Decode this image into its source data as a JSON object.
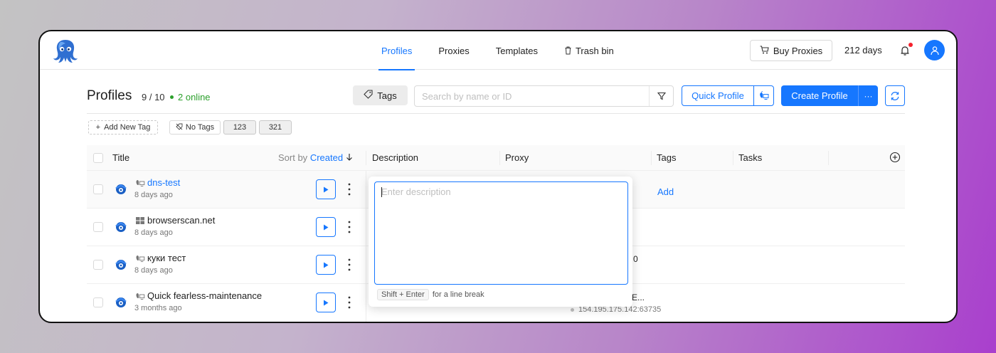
{
  "nav": {
    "items": [
      {
        "label": "Profiles",
        "active": true
      },
      {
        "label": "Proxies",
        "active": false
      },
      {
        "label": "Templates",
        "active": false
      },
      {
        "label": "Trash bin",
        "active": false,
        "icon": "trash-icon"
      }
    ],
    "buy_proxies": "Buy Proxies",
    "days": "212 days"
  },
  "toolbar": {
    "title": "Profiles",
    "count": "9 / 10",
    "online": "2 online",
    "tags_label": "Tags",
    "search_placeholder": "Search by name or ID",
    "quick_profile": "Quick Profile",
    "create_profile": "Create Profile",
    "more_label": "···"
  },
  "tag_chips": {
    "add_new": "Add New Tag",
    "no_tags": "No Tags",
    "tags": [
      "123",
      "321"
    ]
  },
  "table": {
    "headers": {
      "title": "Title",
      "sort_by": "Sort by",
      "sort_field": "Created",
      "description": "Description",
      "proxy": "Proxy",
      "tags": "Tags",
      "tasks": "Tasks"
    },
    "rows": [
      {
        "name": "dns-test",
        "ago": "8 days ago",
        "os": "mac-os-icon",
        "link": true,
        "tags": "Add"
      },
      {
        "name": "browserscan.net",
        "ago": "8 days ago",
        "os": "windows-icon",
        "link": false
      },
      {
        "name": "куки тест",
        "ago": "8 days ago",
        "os": "mac-os-icon",
        "link": false,
        "proxy_fragment": "0"
      },
      {
        "name": "Quick fearless-maintenance",
        "ago": "3 months ago",
        "os": "mac-os-icon",
        "link": false,
        "proxy_fragment": "E...",
        "proxy_address": "154.195.175.142:63735"
      }
    ]
  },
  "description_popover": {
    "placeholder": "Enter description",
    "shortcut": "Shift + Enter",
    "hint": "for a line break"
  },
  "colors": {
    "accent": "#1677ff",
    "online": "#2ca02c",
    "notification": "#f5222d"
  }
}
